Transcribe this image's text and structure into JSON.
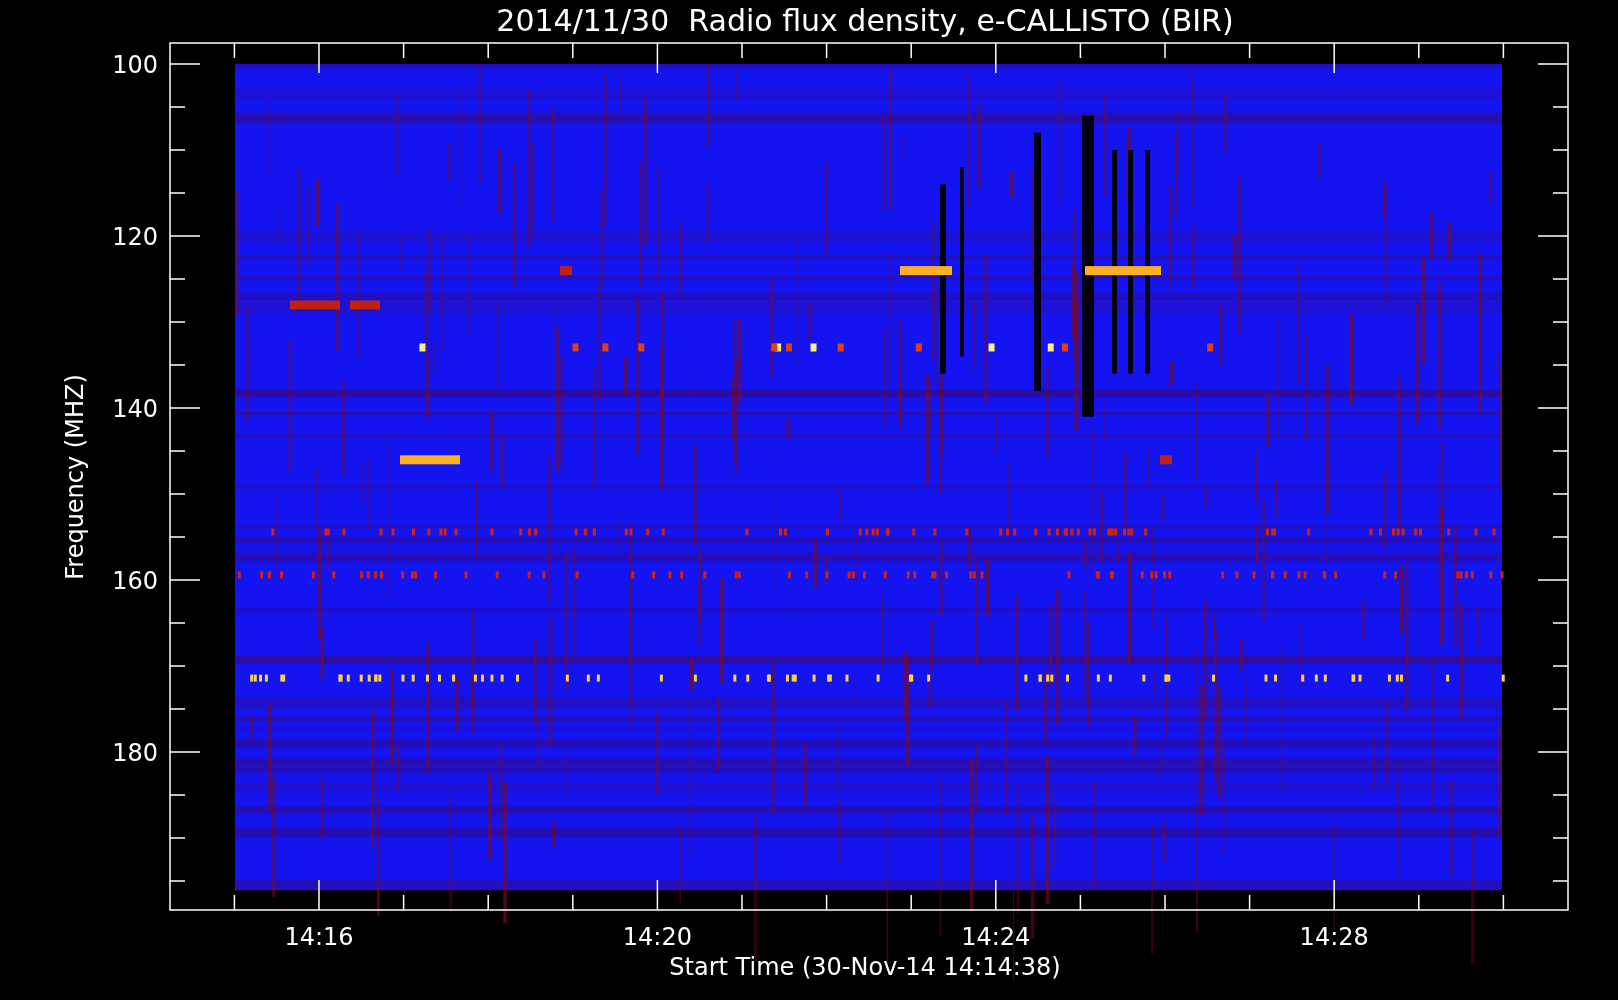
{
  "title": "2014/11/30  Radio flux density, e-CALLISTO (BIR)",
  "y_axis": {
    "label": "Frequency (MHZ)",
    "ticks": [
      "100",
      "120",
      "140",
      "160",
      "180"
    ]
  },
  "x_axis": {
    "label": "Start Time (30-Nov-14 14:14:38)",
    "ticks": [
      "14:16",
      "14:20",
      "14:24",
      "14:28"
    ]
  }
}
